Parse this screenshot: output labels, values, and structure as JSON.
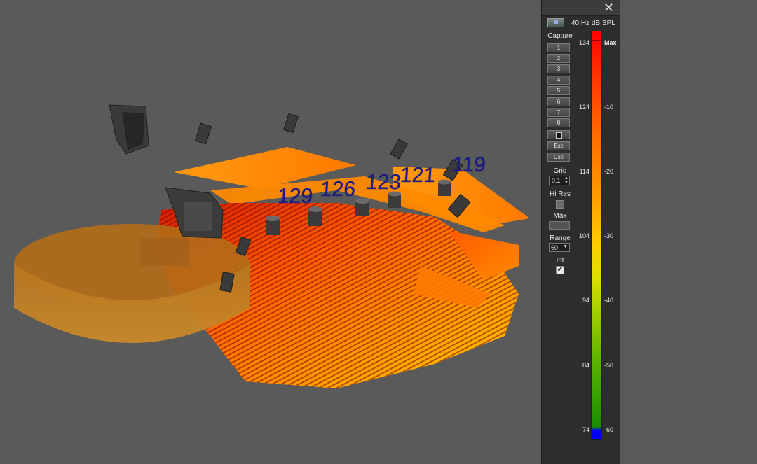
{
  "viewport": {
    "spl_labels": [
      "129",
      "126",
      "123",
      "121",
      "119"
    ]
  },
  "panel": {
    "close_glyph": "✕",
    "title": "40 Hz dB SPL",
    "capture_label": "Capture",
    "capture_buttons": [
      "1",
      "2",
      "3",
      "4",
      "5",
      "6",
      "7",
      "8"
    ],
    "save_icon": "floppy-disk-icon",
    "esc_label": "Esc",
    "use_label": "Use",
    "grid_label": "Grid",
    "grid_value": "0.1",
    "hires_label": "Hi Res",
    "hires_checked": false,
    "max_label": "Max",
    "range_label": "Range",
    "range_value": "60",
    "int_label": "Int",
    "int_checked": true,
    "check_glyph": "✔",
    "scale_left": [
      "134",
      "124",
      "114",
      "104",
      "94",
      "84",
      "74"
    ],
    "scale_right": [
      "Max",
      "-10",
      "-20",
      "-30",
      "-40",
      "-50",
      "-60"
    ]
  },
  "colors": {
    "background": "#5a5a5a",
    "panel": "#2d2d2d",
    "label_blue": "#1a1a8a"
  }
}
